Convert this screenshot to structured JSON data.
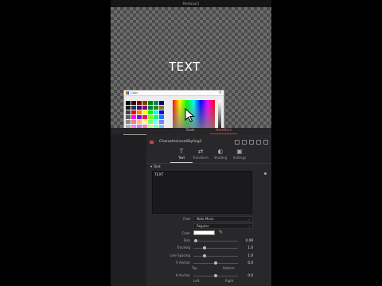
{
  "viewer": {
    "title": "Mediaout1",
    "text": "TEXT"
  },
  "picker": {
    "title": "Color",
    "swatches": [
      "#000000",
      "#3a0000",
      "#7f0000",
      "#7f3f00",
      "#007f00",
      "#007f7f",
      "#00007f",
      "#1a1a1a",
      "#003a7f",
      "#3f007f",
      "#7f007f",
      "#007f3f",
      "#3f7f00",
      "#7f7f00",
      "#404040",
      "#ff0000",
      "#ff7f00",
      "#ffff00",
      "#00ff00",
      "#00ffff",
      "#0000ff",
      "#606060",
      "#ff00ff",
      "#7f00ff",
      "#ff007f",
      "#7fff00",
      "#00ff7f",
      "#007fff",
      "#8a8a8a",
      "#ff7f7f",
      "#ffbf7f",
      "#ffff7f",
      "#7fff7f",
      "#7fffff",
      "#7f7fff",
      "#b0b0b0",
      "#ff7fff",
      "#bf7fff",
      "#ff7fbf",
      "#bfff7f",
      "#7fffbf",
      "#7fbfff",
      "#ffffff",
      "#ffbfbf",
      "#ffdfbf",
      "#ffffbf",
      "#bfffbf",
      "#bfffff",
      "#bfbfff"
    ]
  },
  "tabs": [
    {
      "label": "Tools"
    },
    {
      "label": "Modifiers"
    }
  ],
  "inspector": {
    "tool_name": "CharacterLevelStyling1",
    "subtabs": [
      {
        "label": "Text",
        "glyph": "T"
      },
      {
        "label": "Transform",
        "glyph": "⇄"
      },
      {
        "label": "Shading",
        "glyph": "◐"
      },
      {
        "label": "Settings",
        "glyph": "▣"
      }
    ],
    "section_title": "Text",
    "styled_text": "TEXT",
    "font_label": "Font",
    "font_value": "Noto Mono",
    "style_value": "Regular",
    "color_label": "Color",
    "size_label": "Size",
    "size_value": "0.08",
    "tracking_label": "Tracking",
    "tracking_value": "1.0",
    "line_spacing_label": "Line Spacing",
    "line_spacing_value": "1.0",
    "v_anchor_label": "V Anchor",
    "v_anchor_value": "0.0",
    "v_anchor_min": "Top",
    "v_anchor_max": "Bottom",
    "h_anchor_label": "H Anchor",
    "h_anchor_value": "0.0",
    "h_anchor_min": "Left",
    "h_anchor_max": "Right"
  },
  "colors": {
    "accent": "#cc3333",
    "panel": "#28282b",
    "text_color": "#ffffff"
  }
}
